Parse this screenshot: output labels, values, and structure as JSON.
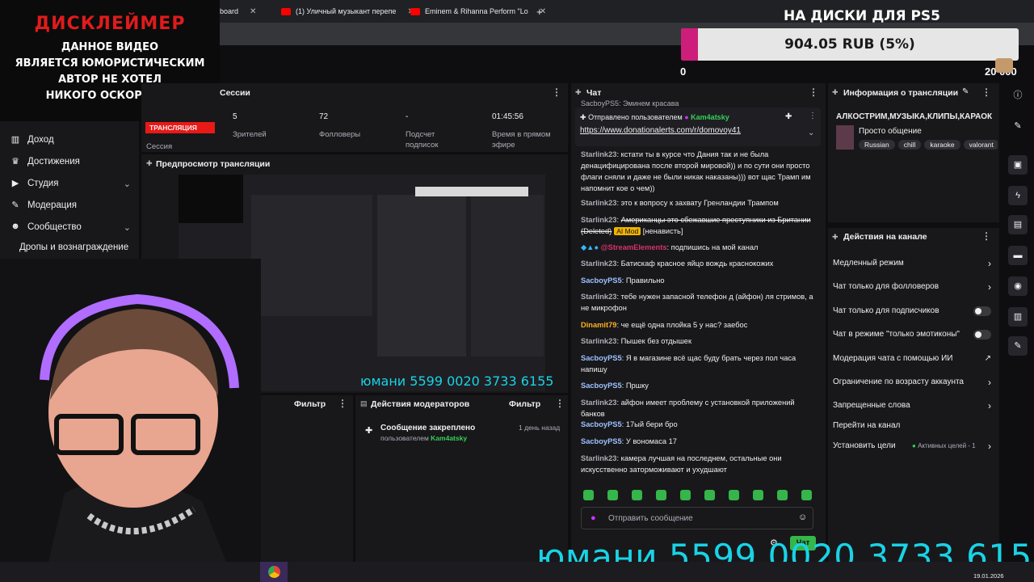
{
  "browser": {
    "tabs": [
      {
        "label": "board",
        "x": ""
      },
      {
        "label": "(1) Уличный музыкант перепе"
      },
      {
        "label": "Eminem & Rihanna Perform \"Lo"
      }
    ],
    "new_tab": "+"
  },
  "disclaimer": {
    "title": "ДИСКЛЕЙМЕР",
    "lines": [
      "ДАННОЕ ВИДЕО",
      "ЯВЛЯЕТСЯ ЮМОРИСТИЧЕСКИМ",
      "АВТОР НЕ ХОТЕЛ",
      "НИКОГО ОСКОРБИТЬ"
    ]
  },
  "donation_goal": {
    "title": "НА ДИСКИ ДЛЯ PS5",
    "amount_text": "904.05 RUB (5%)",
    "progress_fraction": 0.05,
    "min": "0",
    "max": "20 000",
    "fill_color": "#cc1e7a"
  },
  "nav": {
    "items": [
      {
        "label": "Доход",
        "icon": "chart-icon"
      },
      {
        "label": "Достижения",
        "icon": "trophy-icon"
      },
      {
        "label": "Студия",
        "icon": "video-icon"
      },
      {
        "label": "Модерация",
        "icon": "wrench-icon"
      },
      {
        "label": "Сообщество",
        "icon": "people-icon"
      },
      {
        "label": "Дропы и вознаграждение"
      }
    ]
  },
  "session": {
    "header": "Сессии",
    "live_badge": "ТРАНСЛЯЦИЯ",
    "session_label": "Сессия",
    "stats": [
      {
        "value": "5",
        "label": "Зрителей"
      },
      {
        "value": "72",
        "label": "Фолловеры"
      },
      {
        "value": "-",
        "label": "Подсчет подписок"
      },
      {
        "value": "01:45:56",
        "label": "Время в прямом эфире"
      }
    ]
  },
  "preview": {
    "header": "Предпросмотр трансляции",
    "money_text": "юмани 5599 0020 3733 6155"
  },
  "activity": {
    "filter": "Фильтр"
  },
  "mod_actions": {
    "header": "Действия модераторов",
    "filter": "Фильтр",
    "item_title": "Сообщение закреплено",
    "item_by": "пользователем",
    "item_user": "Kam4atsky",
    "item_time": "1 день назад"
  },
  "chat": {
    "header": "Чат",
    "cut_top": "SacboyPS5: Эминем красава",
    "pinned_by_label": "Отправлено пользователем",
    "pinned_user": "Kam4atsky",
    "pinned_link": "https://www.donationalerts.com/r/domovoy41",
    "messages": [
      {
        "user": "Starlink23",
        "color": "#adadb8",
        "text": "кстати ты в курсе что Дания так и не была денацифицирована после второй мировой)) и по сути они просто флаги сняли и даже не были никак наказаны))) вот щас Трамп им напомнит кое о чем))"
      },
      {
        "user": "Starlink23",
        "color": "#adadb8",
        "text": "это к вопросу к захвату Гренландии Трампом"
      },
      {
        "user": "Starlink23",
        "color": "#adadb8",
        "text": "Американцы это сбежавшие преступники из Британии (Deleted)",
        "badge": "AI Mod",
        "extra": "[ненависть]"
      },
      {
        "user": "@StreamElements",
        "color": "#d8326b",
        "text": "подпишись на мой канал",
        "system": true
      },
      {
        "user": "Starlink23",
        "color": "#adadb8",
        "text": "Батискаф красное яйцо вождь краснокожих"
      },
      {
        "user": "SacboyPS5",
        "color": "#9ec1ff",
        "text": "Правильно"
      },
      {
        "user": "Starlink23",
        "color": "#adadb8",
        "text": "тебе нужен запасной телефон д (айфон) ля стримов, а не микрофон"
      },
      {
        "user": "Dinamit79",
        "color": "#ffb020",
        "text": "че ещё одна плойка 5 у нас? заебос"
      },
      {
        "user": "Starlink23",
        "color": "#adadb8",
        "text": "Пышек без отдышек"
      },
      {
        "user": "SacboyPS5",
        "color": "#9ec1ff",
        "text": "Я в магазине всё щас буду брать через пол часа напишу"
      },
      {
        "user": "SacboyPS5",
        "color": "#9ec1ff",
        "text": "Пршку"
      },
      {
        "user": "Starlink23",
        "color": "#adadb8",
        "text": "айфон имеет проблему с установкой приложений банков"
      },
      {
        "user": "SacboyPS5",
        "color": "#9ec1ff",
        "text": "17ый бери бро"
      },
      {
        "user": "SacboyPS5",
        "color": "#9ec1ff",
        "text": "У вономаса 17"
      },
      {
        "user": "Starlink23",
        "color": "#adadb8",
        "text": "камера лучшая на последнем, остальные они искусственно заторможивают и ухудшают"
      }
    ],
    "input_placeholder": "Отправить сообщение",
    "send_label": "Чат"
  },
  "stream_info": {
    "header": "Информация о трансляции",
    "title": "АЛКОСТРИМ,МУЗЫКА,КЛИПЫ,КАРАОК",
    "category": "Просто общение",
    "tags": [
      "Russian",
      "chill",
      "karaoke",
      "valorant"
    ]
  },
  "channel_actions": {
    "header": "Действия на канале",
    "rows": [
      {
        "label": "Медленный режим",
        "kind": "chevron"
      },
      {
        "label": "Чат только для фолловеров",
        "kind": "chevron"
      },
      {
        "label": "Чат только для подписчиков",
        "kind": "toggle"
      },
      {
        "label": "Чат в режиме \"только эмотиконы\"",
        "kind": "toggle"
      },
      {
        "label": "Модерация чата с помощью ИИ",
        "kind": "external"
      },
      {
        "label": "Ограничение по возрасту аккаунта",
        "kind": "chevron"
      },
      {
        "label": "Запрещенные слова",
        "kind": "chevron"
      },
      {
        "label": "Перейти на канал",
        "kind": "none"
      },
      {
        "label": "Установить цели",
        "kind": "chevron",
        "extra": "Активных целей - 1"
      }
    ]
  },
  "overlay": {
    "money_text": "юмани 5599 0020 3733 6155"
  },
  "taskbar": {
    "date": "19.01.2026"
  },
  "side_toolbar": {
    "icons": [
      "info-icon",
      "pencil-icon",
      "clip-icon",
      "flash-icon",
      "notes-icon",
      "chat-icon",
      "broadcast-icon",
      "panel-icon",
      "wrench-icon"
    ]
  }
}
